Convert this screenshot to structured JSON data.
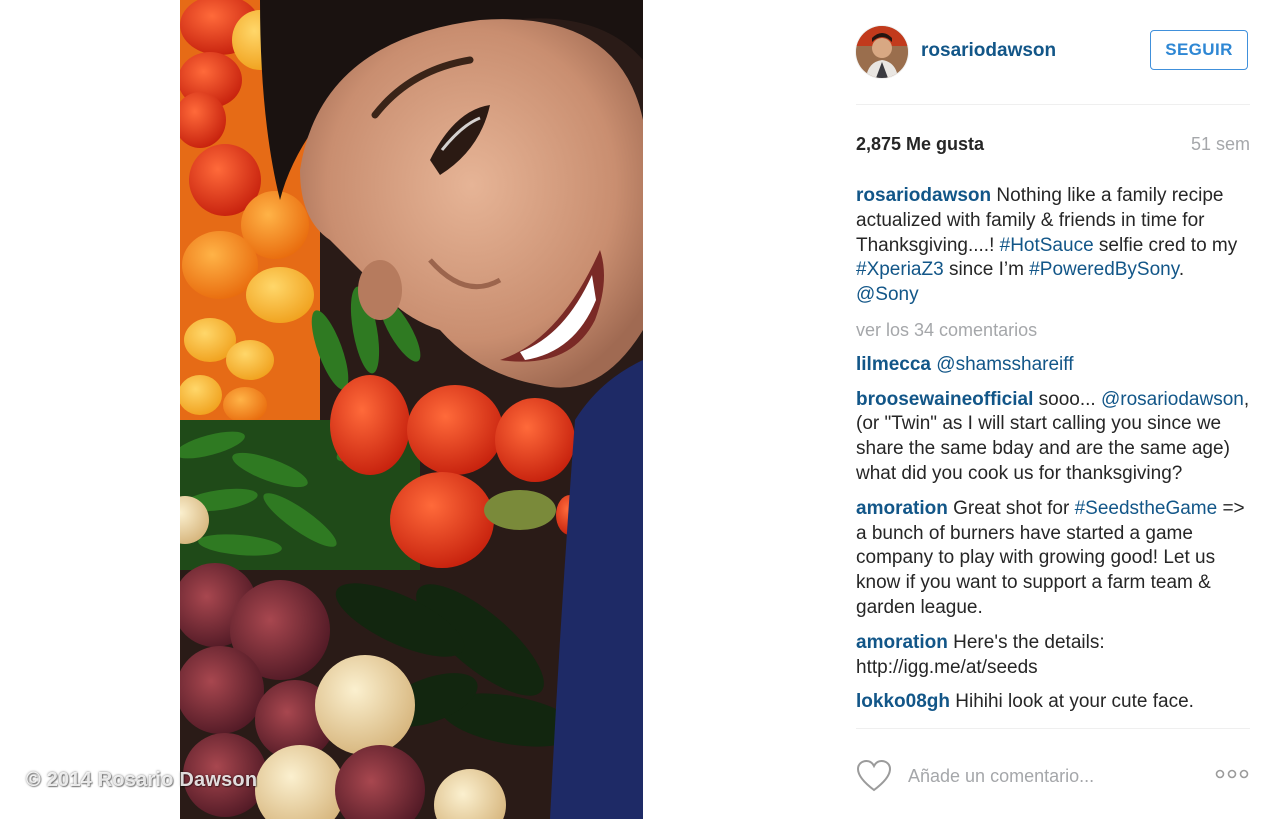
{
  "photo": {
    "watermark": "© 2014 Rosario Dawson"
  },
  "header": {
    "username": "rosariodawson",
    "follow_label": "SEGUIR"
  },
  "stats": {
    "likes": "2,875 Me gusta",
    "timestamp": "51 sem"
  },
  "caption": {
    "user": "rosariodawson",
    "text_1": " Nothing like a family recipe actualized with family & friends in time for Thanksgiving....! ",
    "tag_1": "#HotSauce",
    "text_2": " selfie cred to my ",
    "tag_2": "#XperiaZ3",
    "text_3": " since I’m ",
    "tag_3": "#PoweredBySony",
    "text_4": ". ",
    "mention": "@Sony"
  },
  "view_all": "ver los 34 comentarios",
  "comments": [
    {
      "user": "lilmecca",
      "mention": "@shamsshareiff"
    },
    {
      "user": "broosewaineofficial",
      "text_1": " sooo... ",
      "mention": "@rosariodawson",
      "text_2": ", (or \"Twin\" as I will start calling you since we share the same bday and are the same age) what did you cook us for thanksgiving?"
    },
    {
      "user": "amoration",
      "text_1": " Great shot for ",
      "tag": "#SeedstheGame",
      "text_2": " => a bunch of burners have started a game company to play with growing good! Let us know if you want to support a farm team & garden league."
    },
    {
      "user": "amoration",
      "text": " Here's the details: http://igg.me/at/seeds"
    },
    {
      "user": "lokko08gh",
      "text": " Hihihi look at your cute face."
    }
  ],
  "footer": {
    "comment_placeholder": "Añade un comentario...",
    "icons": [
      "heart-icon",
      "more-options-icon"
    ]
  },
  "colors": {
    "link_blue": "#125688",
    "follow_blue": "#2e87d4",
    "muted_gray": "#a5a7aa",
    "divider": "#efefef"
  }
}
